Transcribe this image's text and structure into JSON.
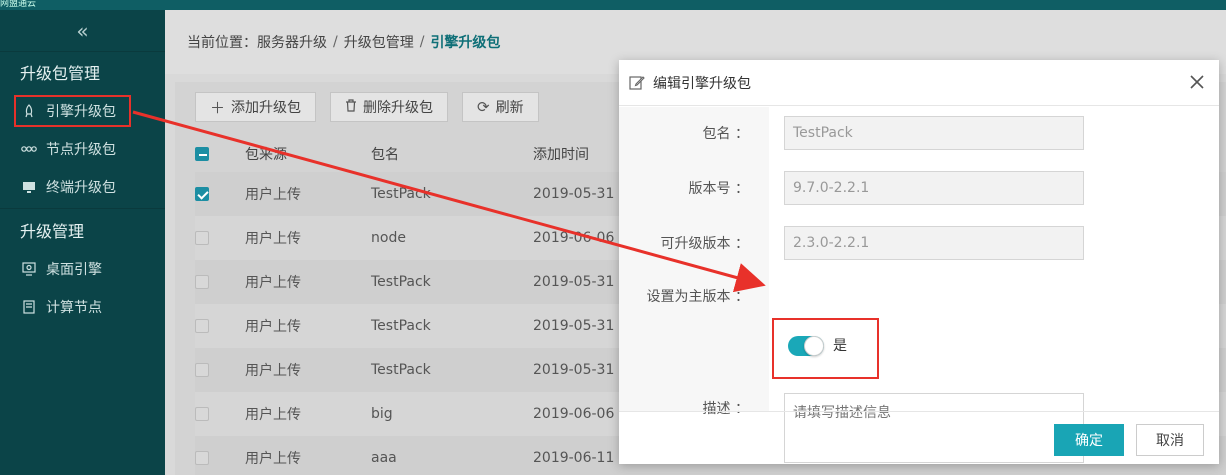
{
  "topbar": {
    "brand": "网盟通云"
  },
  "sidebar": {
    "collapse_icon": "«",
    "groups": [
      {
        "title": "升级包管理"
      },
      {
        "title": "升级管理"
      }
    ],
    "items": [
      {
        "label": "引擎升级包",
        "icon": "rocket-icon"
      },
      {
        "label": "节点升级包",
        "icon": "nodes-icon"
      },
      {
        "label": "终端升级包",
        "icon": "monitor-icon"
      },
      {
        "label": "桌面引擎",
        "icon": "desktop-icon"
      },
      {
        "label": "计算节点",
        "icon": "server-icon"
      }
    ]
  },
  "breadcrumb": {
    "prefix": "当前位置：",
    "parts": [
      "服务器升级",
      "升级包管理"
    ],
    "current": "引擎升级包",
    "separator": "/"
  },
  "toolbar": {
    "add": "添加升级包",
    "delete": "删除升级包",
    "refresh": "刷新"
  },
  "table": {
    "headers": [
      "包来源",
      "包名",
      "添加时间"
    ],
    "rows": [
      {
        "checked": true,
        "source": "用户上传",
        "name": "TestPack",
        "time": "2019-05-31"
      },
      {
        "checked": false,
        "source": "用户上传",
        "name": "node",
        "time": "2019-06-06"
      },
      {
        "checked": false,
        "source": "用户上传",
        "name": "TestPack",
        "time": "2019-05-31"
      },
      {
        "checked": false,
        "source": "用户上传",
        "name": "TestPack",
        "time": "2019-05-31"
      },
      {
        "checked": false,
        "source": "用户上传",
        "name": "TestPack",
        "time": "2019-05-31"
      },
      {
        "checked": false,
        "source": "用户上传",
        "name": "big",
        "time": "2019-06-06"
      },
      {
        "checked": false,
        "source": "用户上传",
        "name": "aaa",
        "time": "2019-06-11"
      }
    ]
  },
  "modal": {
    "title": "编辑引擎升级包",
    "fields": {
      "package_name": {
        "label": "包名 ：",
        "value": "TestPack"
      },
      "version": {
        "label": "版本号 ：",
        "value": "9.7.0-2.2.1"
      },
      "upgradable": {
        "label": "可升级版本 ：",
        "value": "2.3.0-2.2.1"
      },
      "main_version": {
        "label": "设置为主版本 ：",
        "switch_on": true,
        "switch_text": "是"
      },
      "description": {
        "label": "描述 ：",
        "placeholder": "请填写描述信息"
      }
    },
    "ok": "确定",
    "cancel": "取消"
  },
  "colors": {
    "sidebar_bg": "#0b4448",
    "accent": "#19a5b5",
    "highlight": "#e8312a",
    "breadcrumb_current": "#0e6f77"
  }
}
